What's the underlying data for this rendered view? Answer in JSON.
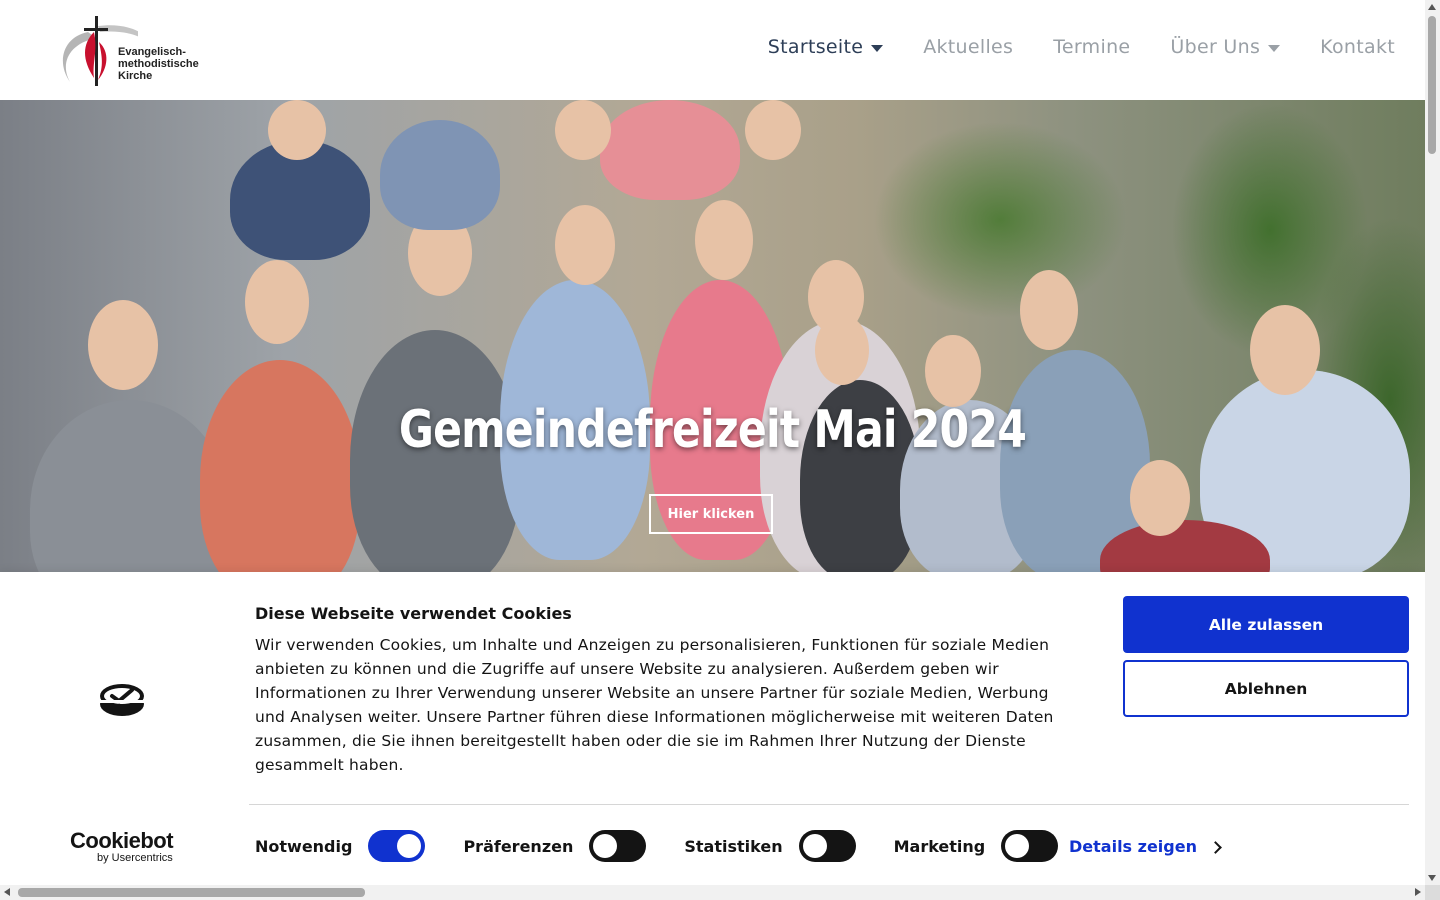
{
  "header": {
    "logo_text_line1": "Evangelisch-",
    "logo_text_line2": "methodistische",
    "logo_text_line3": "Kirche",
    "nav": [
      {
        "label": "Startseite",
        "dropdown": true,
        "active": true
      },
      {
        "label": "Aktuelles",
        "dropdown": false
      },
      {
        "label": "Termine",
        "dropdown": false
      },
      {
        "label": "Über Uns",
        "dropdown": true
      },
      {
        "label": "Kontakt",
        "dropdown": false
      }
    ]
  },
  "hero": {
    "title": "Gemeindefreizeit Mai 2024",
    "button_label": "Hier klicken"
  },
  "cookie": {
    "title": "Diese Webseite verwendet Cookies",
    "text": "Wir verwenden Cookies, um Inhalte und Anzeigen zu personalisieren, Funktionen für soziale Medien anbieten zu können und die Zugriffe auf unsere Website zu analysieren. Außerdem geben wir Informationen zu Ihrer Verwendung unserer Website an unsere Partner für soziale Medien, Werbung und Analysen weiter. Unsere Partner führen diese Informationen möglicherweise mit weiteren Daten zusammen, die Sie ihnen bereitgestellt haben oder die sie im Rahmen Ihrer Nutzung der Dienste gesammelt haben.",
    "accept_label": "Alle zulassen",
    "deny_label": "Ablehnen",
    "brand_name": "Cookiebot",
    "brand_sub": "by Usercentrics",
    "toggles": [
      {
        "label": "Notwendig",
        "on": true
      },
      {
        "label": "Präferenzen",
        "on": false
      },
      {
        "label": "Statistiken",
        "on": false
      },
      {
        "label": "Marketing",
        "on": false
      }
    ],
    "details_label": "Details zeigen"
  },
  "colors": {
    "accent": "#1032cf",
    "nav_active": "#2d3e57",
    "nav_inactive": "#9aa0a6",
    "logo_red": "#c8102e"
  }
}
